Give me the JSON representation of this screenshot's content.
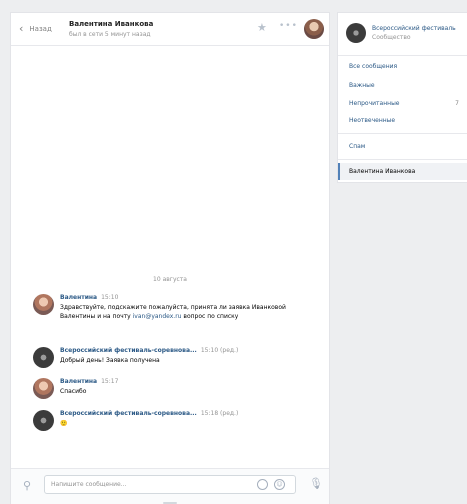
{
  "header": {
    "back_label": "Назад",
    "contact_name": "Валентина Иванкова",
    "status": "был в сети 5 минут назад"
  },
  "date_separator": "10 августа",
  "messages": [
    {
      "author": "Валентина",
      "time": "15:10",
      "text_before": "Здравствуйте, подскажите пожалуйста, принята ли заявка Иванковой Валентины и на почту",
      "link": "ivan@yandex.ru",
      "text_after": "вопрос по списку",
      "avatar": "person"
    },
    {
      "author": "Всероссийский фестиваль-соревнова...",
      "time": "15:10 (ред.)",
      "text": "Добрый день! Заявка получена",
      "avatar": "fest"
    },
    {
      "author": "Валентина",
      "time": "15:17",
      "text": "Спасибо",
      "avatar": "person"
    },
    {
      "author": "Всероссийский фестиваль-соревнова...",
      "time": "15:18 (ред.)",
      "text": "🙂",
      "avatar": "fest"
    }
  ],
  "input": {
    "placeholder": "Напишите сообщение..."
  },
  "sidebar": {
    "group_name": "Всероссийский фестиваль",
    "group_sub": "Сообщество",
    "items": [
      {
        "label": "Все сообщения"
      },
      {
        "label": "Важные"
      },
      {
        "label": "Непрочитанные",
        "count": "7"
      },
      {
        "label": "Неотвеченные"
      },
      {
        "label": "Спам"
      }
    ],
    "active_chat": "Валентина Иванкова"
  },
  "colors": {
    "link": "#2a5885",
    "accent": "#5181b8",
    "page_bg": "#edeef0"
  }
}
